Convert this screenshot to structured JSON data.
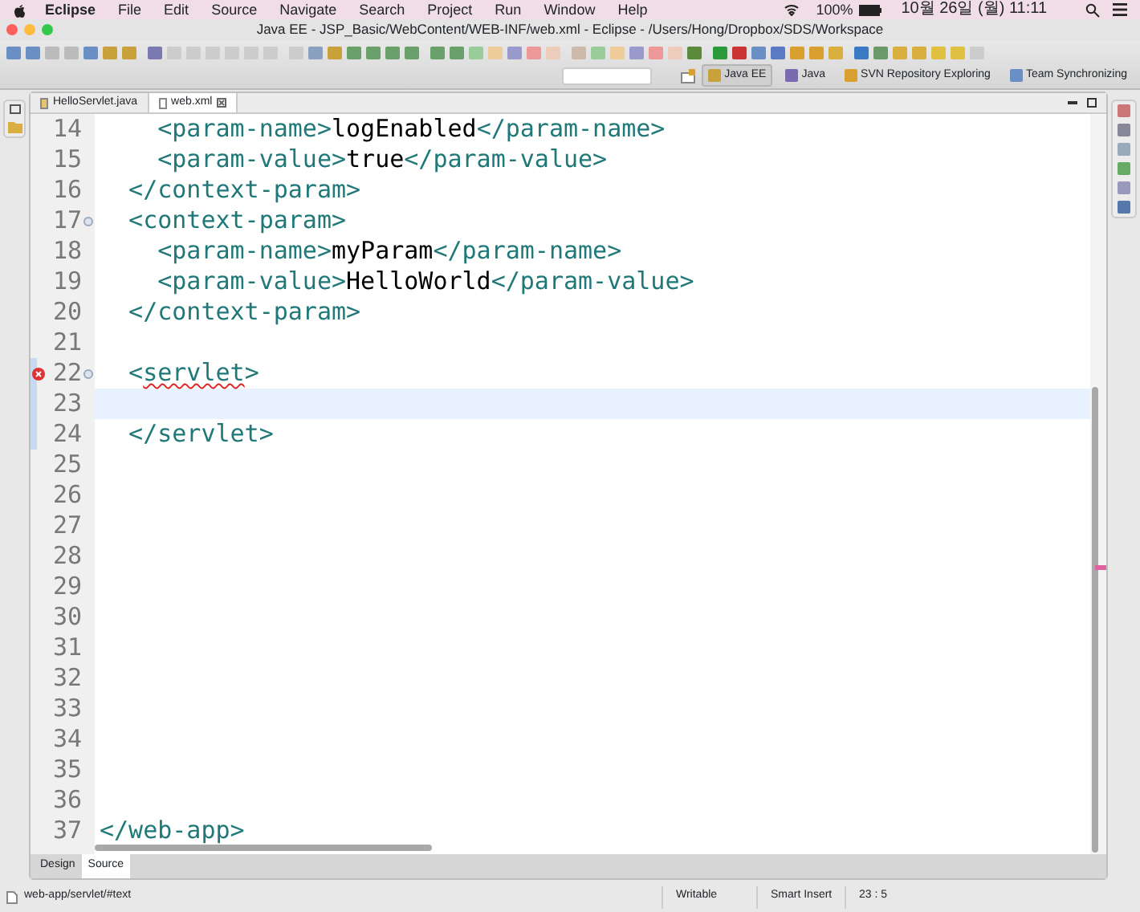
{
  "menu_bar": {
    "app": "Eclipse",
    "items": [
      "File",
      "Edit",
      "Source",
      "Navigate",
      "Search",
      "Project",
      "Run",
      "Window",
      "Help"
    ],
    "battery": "100%",
    "clock": "10월 26일 (월) 11:11"
  },
  "window": {
    "title": "Java EE - JSP_Basic/WebContent/WEB-INF/web.xml - Eclipse - /Users/Hong/Dropbox/SDS/Workspace"
  },
  "perspectives": [
    {
      "label": "Java EE",
      "selected": true
    },
    {
      "label": "Java",
      "selected": false
    },
    {
      "label": "SVN Repository Exploring",
      "selected": false
    },
    {
      "label": "Team Synchronizing",
      "selected": false
    }
  ],
  "editor_tabs": [
    {
      "label": "HelloServlet.java",
      "selected": false,
      "closable": false
    },
    {
      "label": "web.xml",
      "selected": true,
      "closable": true
    }
  ],
  "code_lines": [
    {
      "number": "14",
      "parts": [
        {
          "kind": "tag",
          "text": "    <param-name>"
        },
        {
          "kind": "text",
          "text": "logEnabled"
        },
        {
          "kind": "tag",
          "text": "</param-name>"
        }
      ]
    },
    {
      "number": "15",
      "parts": [
        {
          "kind": "tag",
          "text": "    <param-value>"
        },
        {
          "kind": "text",
          "text": "true"
        },
        {
          "kind": "tag",
          "text": "</param-value>"
        }
      ]
    },
    {
      "number": "16",
      "parts": [
        {
          "kind": "tag",
          "text": "  </context-param>"
        }
      ]
    },
    {
      "number": "17",
      "fold": true,
      "parts": [
        {
          "kind": "tag",
          "text": "  <context-param>"
        }
      ]
    },
    {
      "number": "18",
      "parts": [
        {
          "kind": "tag",
          "text": "    <param-name>"
        },
        {
          "kind": "text",
          "text": "myParam"
        },
        {
          "kind": "tag",
          "text": "</param-name>"
        }
      ]
    },
    {
      "number": "19",
      "parts": [
        {
          "kind": "tag",
          "text": "    <param-value>"
        },
        {
          "kind": "text",
          "text": "HelloWorld"
        },
        {
          "kind": "tag",
          "text": "</param-value>"
        }
      ]
    },
    {
      "number": "20",
      "parts": [
        {
          "kind": "tag",
          "text": "  </context-param>"
        }
      ]
    },
    {
      "number": "21"
    },
    {
      "number": "22",
      "fold": true,
      "error": true,
      "parts": [
        {
          "kind": "tag",
          "text": "  <"
        },
        {
          "kind": "error",
          "text": "servlet"
        },
        {
          "kind": "tag",
          "text": ">"
        }
      ]
    },
    {
      "number": "23",
      "current": true
    },
    {
      "number": "24",
      "parts": [
        {
          "kind": "tag",
          "text": "  </servlet>"
        }
      ]
    },
    {
      "number": "25"
    },
    {
      "number": "26"
    },
    {
      "number": "27"
    },
    {
      "number": "28"
    },
    {
      "number": "29"
    },
    {
      "number": "30"
    },
    {
      "number": "31"
    },
    {
      "number": "32"
    },
    {
      "number": "33"
    },
    {
      "number": "34"
    },
    {
      "number": "35"
    },
    {
      "number": "36"
    },
    {
      "number": "37",
      "parts": [
        {
          "kind": "tag",
          "text": "</web-app>"
        }
      ]
    }
  ],
  "bottom_tabs": [
    {
      "label": "Design",
      "selected": false
    },
    {
      "label": "Source",
      "selected": true
    }
  ],
  "status_bar": {
    "path": "web-app/servlet/#text",
    "mode": "Writable",
    "insert": "Smart Insert",
    "position": "23 : 5"
  }
}
